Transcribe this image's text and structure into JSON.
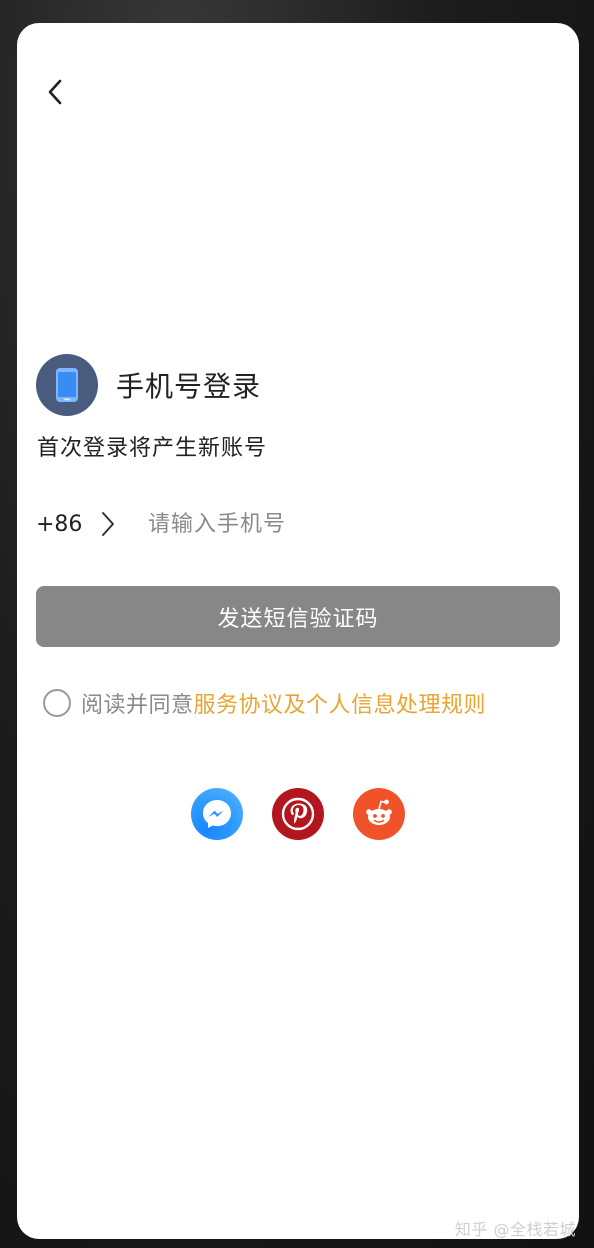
{
  "header": {
    "back_icon": "chevron-left-icon"
  },
  "brand": {
    "logo_icon": "smartphone-icon",
    "logo_color": "#4a5b80",
    "title": "手机号登录"
  },
  "subtitle": "首次登录将产生新账号",
  "phone": {
    "country_code": "+86",
    "country_chevron_icon": "chevron-right-icon",
    "placeholder": "请输入手机号",
    "value": ""
  },
  "send_button": {
    "label": "发送短信验证码",
    "color": "#878787"
  },
  "agreement": {
    "checked": false,
    "prefix": "阅读并同意",
    "link_text": "服务协议及个人信息处理规则",
    "link_color": "#e9a532"
  },
  "social_logins": [
    {
      "name": "messenger",
      "icon": "messenger-icon"
    },
    {
      "name": "pinterest",
      "icon": "pinterest-icon"
    },
    {
      "name": "reddit",
      "icon": "reddit-icon"
    }
  ],
  "watermark": "知乎 @全栈若城"
}
